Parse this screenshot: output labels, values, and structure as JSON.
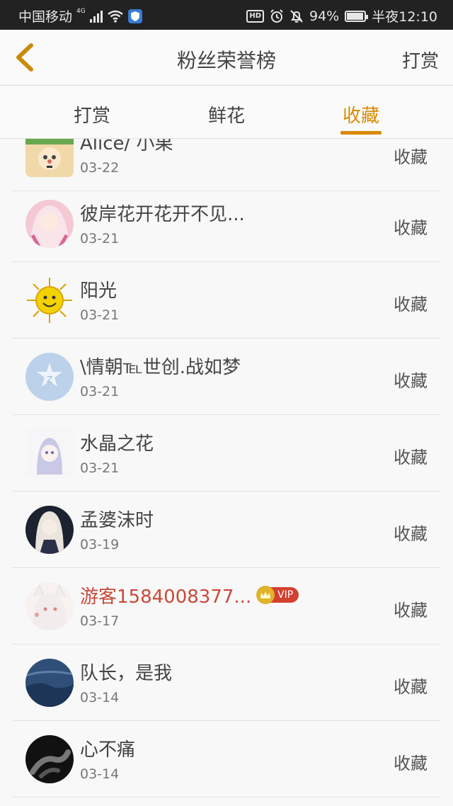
{
  "status_bar": {
    "carrier": "中国移动",
    "network": "4G",
    "battery": "94%",
    "battery_level": 0.94,
    "time": "半夜12:10",
    "hd": "HD"
  },
  "header": {
    "title": "粉丝荣誉榜",
    "action": "打赏"
  },
  "tabs": [
    {
      "label": "打赏",
      "active": false
    },
    {
      "label": "鲜花",
      "active": false
    },
    {
      "label": "收藏",
      "active": true
    }
  ],
  "accent_color": "#d98a00",
  "list": [
    {
      "name": "Alice/ 小果",
      "date": "03-22",
      "action": "收藏",
      "vip": false
    },
    {
      "name": "彼岸花开花开不见...",
      "date": "03-21",
      "action": "收藏",
      "vip": false
    },
    {
      "name": "阳光",
      "date": "03-21",
      "action": "收藏",
      "vip": false
    },
    {
      "name": "\\情朝℡世创.战如梦",
      "date": "03-21",
      "action": "收藏",
      "vip": false
    },
    {
      "name": "水晶之花",
      "date": "03-21",
      "action": "收藏",
      "vip": false
    },
    {
      "name": "孟婆沫时",
      "date": "03-19",
      "action": "收藏",
      "vip": false
    },
    {
      "name": "游客1584008377...",
      "date": "03-17",
      "action": "收藏",
      "vip": true,
      "vip_label": "VIP"
    },
    {
      "name": "队长，是我",
      "date": "03-14",
      "action": "收藏",
      "vip": false
    },
    {
      "name": "心不痛",
      "date": "03-14",
      "action": "收藏",
      "vip": false
    }
  ]
}
